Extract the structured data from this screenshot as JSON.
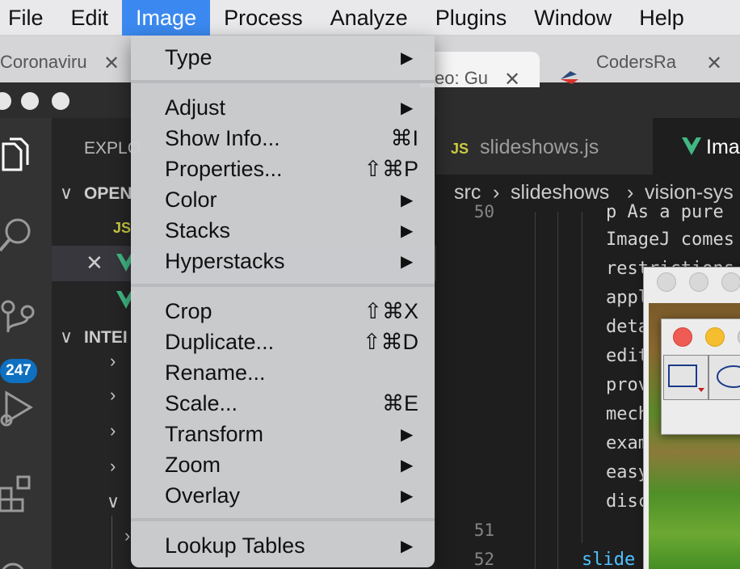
{
  "menubar": {
    "items": [
      "File",
      "Edit",
      "Image",
      "Process",
      "Analyze",
      "Plugins",
      "Window",
      "Help"
    ],
    "active_index": 2
  },
  "browser_tabs": [
    {
      "label": "Coronaviru",
      "close": "✕"
    },
    {
      "label": "eo: Gu",
      "close": "✕"
    },
    {
      "label": "CodersRa",
      "close": "✕"
    }
  ],
  "vscode": {
    "sidebar": {
      "explorer_title": "EXPLO",
      "open_editors_title": "OPEN",
      "outline_title": "INTEI",
      "js_label": "JS",
      "source_control_badge": "247"
    },
    "editor_tabs": [
      {
        "badge": "JS",
        "label": "slideshows.js"
      },
      {
        "badge": "V",
        "label": "Ima"
      }
    ],
    "breadcrumb": [
      "src",
      "slideshows",
      "vision-sys"
    ],
    "code": {
      "line_numbers": [
        "50",
        "51",
        "52"
      ],
      "lines": [
        "p As a pure",
        "ImageJ comes",
        "restrictions",
        "appl",
        "deta",
        "edit",
        "prov",
        "mech",
        "exam",
        "easy",
        "disc",
        "",
        "slide"
      ]
    }
  },
  "image_menu": {
    "groups": [
      [
        {
          "label": "Type",
          "submenu": true,
          "shortcut": ""
        }
      ],
      [
        {
          "label": "Adjust",
          "submenu": true,
          "shortcut": ""
        },
        {
          "label": "Show Info...",
          "submenu": false,
          "shortcut": "⌘I"
        },
        {
          "label": "Properties...",
          "submenu": false,
          "shortcut": "⇧⌘P"
        },
        {
          "label": "Color",
          "submenu": true,
          "shortcut": ""
        },
        {
          "label": "Stacks",
          "submenu": true,
          "shortcut": ""
        },
        {
          "label": "Hyperstacks",
          "submenu": true,
          "shortcut": ""
        }
      ],
      [
        {
          "label": "Crop",
          "submenu": false,
          "shortcut": "⇧⌘X"
        },
        {
          "label": "Duplicate...",
          "submenu": false,
          "shortcut": "⇧⌘D"
        },
        {
          "label": "Rename...",
          "submenu": false,
          "shortcut": ""
        },
        {
          "label": "Scale...",
          "submenu": false,
          "shortcut": "⌘E"
        },
        {
          "label": "Transform",
          "submenu": true,
          "shortcut": ""
        },
        {
          "label": "Zoom",
          "submenu": true,
          "shortcut": ""
        },
        {
          "label": "Overlay",
          "submenu": true,
          "shortcut": ""
        }
      ],
      [
        {
          "label": "Lookup Tables",
          "submenu": true,
          "shortcut": ""
        }
      ]
    ],
    "submenu_arrow": "▶"
  },
  "colors": {
    "menu_highlight": "#3b89f0",
    "vscode_bg": "#1e1e1e",
    "badge_blue": "#0e70c0",
    "vue_green": "#41b883",
    "js_yellow": "#cbcb41"
  },
  "icons": {
    "explorer": "files-icon",
    "search": "search-icon",
    "source_control": "source-control-icon",
    "run": "run-debug-icon",
    "extensions": "extensions-icon",
    "vue": "vue-logo-icon",
    "rectangle_tool": "rectangle-tool-icon",
    "oval_tool": "oval-tool-icon"
  }
}
